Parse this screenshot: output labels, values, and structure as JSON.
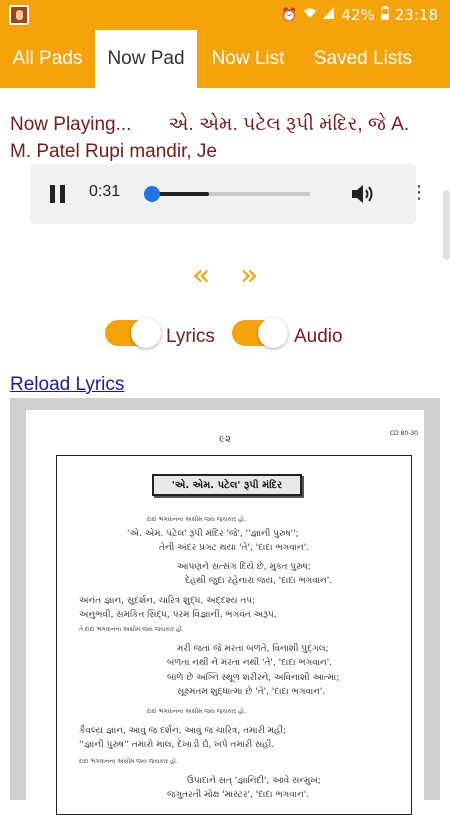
{
  "status_bar": {
    "battery": "42%",
    "time": "23:18"
  },
  "tabs": [
    {
      "label": "All Pads",
      "active": false
    },
    {
      "label": "Now Pad",
      "active": true
    },
    {
      "label": "Now List",
      "active": false
    },
    {
      "label": "Saved Lists",
      "active": false
    }
  ],
  "now_playing": {
    "label": "Now Playing...",
    "title": "એ. એમ. પટેલ રૂપી મંદિર, જે A. M. Patel Rupi mandir, Je"
  },
  "player": {
    "current_time": "0:31",
    "progress": 0.36
  },
  "nav": {
    "prev": "«",
    "next": "»"
  },
  "toggles": {
    "lyrics": {
      "label": "Lyrics",
      "on": true
    },
    "audio": {
      "label": "Audio",
      "on": true
    }
  },
  "reload_link": "Reload Lyrics",
  "lyrics_page": {
    "page_number": "૯૨",
    "cd_code": "CD 80-30",
    "heading": "'એ. એમ. પટેલ' રૂપી મંદિર",
    "lines": [
      {
        "text": "દાદા ભગવાનના અસીમ જય જયકાર હો.",
        "small": true
      },
      {
        "text": "'એ. એમ. પટેલ' રૂપી મંદિર 'જે', ''જ્ઞાની પુરુષ'';",
        "small": false
      },
      {
        "text": "તેની અંદર પ્રગટ થયા 'તે', 'દાદા ભગવાન'.",
        "small": false
      },
      {
        "text": "આપણને સત્સંગ દિયે છે, મુક્ત પુરુષ;",
        "small": false
      },
      {
        "text": "દેહથી જુદા રહેનારા જય, 'દાદા ભગવાન'.",
        "small": false
      },
      {
        "text": "અનંત જ્ઞાન, સુદર્શન, ચારિત્ર શુદ્ધ, અદ્દશ્ય તપ;",
        "small": false
      },
      {
        "text": "અનુભવી, સમકિત સિદ્ધ, પરમ વિજ્ઞાની, ભગવંત અરૂપ,",
        "small": false
      },
      {
        "text": "તે દાદા ભગવાનના અસીમ જય જયકાર હો.",
        "small": true
      },
      {
        "text": "મરી જતાં જે મરતાં બળતે, વિનાશી પુદ્ગલ;",
        "small": false
      },
      {
        "text": "બળતા નથી ને મરતા નથી 'તે', 'દાદા ભગવાન'.",
        "small": false
      },
      {
        "text": "બાળે છે અગ્નિ સ્થૂળ શરીરને, અવિનાશી આત્મા;",
        "small": false
      },
      {
        "text": "સૂક્ષ્મતમ શુદ્ધાત્મા છે 'તે', 'દાદા ભગવાન'.",
        "small": false
      },
      {
        "text": "દાદા ભગવાનના અસીમ જય જયકાર હો.",
        "small": true
      },
      {
        "text": "કૈવલ્ય જ્ઞાન, આવું જ દર્શન, આવું જ ચારિત્ર, તમારી મહીં;",
        "small": false
      },
      {
        "text": "''જ્ઞાની પુરુષ'' તમારો માલ, દેખાડી દ્યે, ખપે તમારી સહી.",
        "small": false
      },
      {
        "text": "દાદા ભગવાનના અસીમ જય જયકાર હો.",
        "small": true
      },
      {
        "text": "ઉપાદાને સત્ 'જ્ઞાનિંદી', આવે સન્મુખ;",
        "small": false
      },
      {
        "text": "જગુતરતી મોક્ષ 'માસ્ટર', 'દાદા ભગવાન'.",
        "small": false
      }
    ]
  }
}
